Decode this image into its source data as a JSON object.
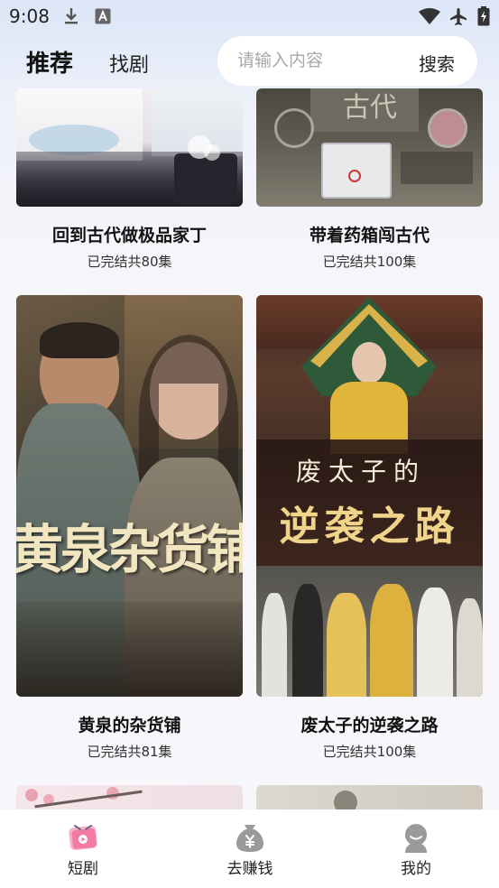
{
  "status_bar": {
    "time": "9:08"
  },
  "header": {
    "tabs": [
      {
        "label": "推荐",
        "active": true
      },
      {
        "label": "找剧",
        "active": false
      }
    ],
    "search": {
      "placeholder": "请输入内容",
      "button_label": "搜索"
    }
  },
  "feed": {
    "dramas": [
      {
        "title": "回到古代做极品家丁",
        "status": "已完结共80集"
      },
      {
        "title": "带着药箱闯古代",
        "status": "已完结共100集"
      },
      {
        "title": "黄泉的杂货铺",
        "status": "已完结共81集",
        "poster_caption": "黄泉杂货铺"
      },
      {
        "title": "废太子的逆袭之路",
        "status": "已完结共100集",
        "poster_caption_top": "废太子的",
        "poster_caption_bottom": "逆袭之路"
      }
    ],
    "poster_caption_medicine": "古代"
  },
  "bottom_nav": [
    {
      "label": "短剧",
      "icon": "drama-icon",
      "active": true
    },
    {
      "label": "去赚钱",
      "icon": "money-bag-icon",
      "active": false
    },
    {
      "label": "我的",
      "icon": "profile-icon",
      "active": false
    }
  ],
  "colors": {
    "accent": "#f06a8d",
    "text": "#111111",
    "muted": "#a8a8a8",
    "nav_icon": "#9a9a9a"
  }
}
